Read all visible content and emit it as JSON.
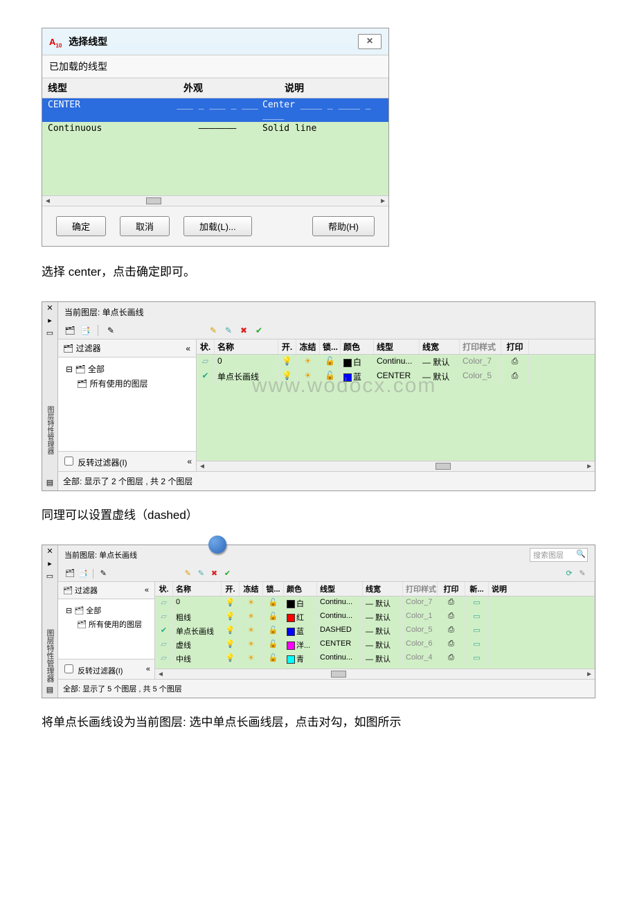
{
  "dialog1": {
    "title": "选择线型",
    "section_label": "已加载的线型",
    "headers": {
      "linetype": "线型",
      "appearance": "外观",
      "description": "说明"
    },
    "rows": [
      {
        "name": "CENTER",
        "appearance": "___ _ ___ _ ___",
        "desc": "Center ____ _ ____ _ ____"
      },
      {
        "name": "Continuous",
        "appearance": "———————",
        "desc": "Solid line"
      }
    ],
    "buttons": {
      "ok": "确定",
      "cancel": "取消",
      "load": "加载(L)...",
      "help": "帮助(H)"
    }
  },
  "text1": "选择 center，点击确定即可。",
  "panel2": {
    "current_label": "当前图层: 单点长画线",
    "filter_label": "过滤器",
    "tree_all": "全部",
    "tree_used": "所有使用的图层",
    "invert_filter": "反转过滤器(I)",
    "headers": {
      "status": "状.",
      "name": "名称",
      "on": "开.",
      "freeze": "冻结",
      "lock": "锁...",
      "color": "颜色",
      "linetype": "线型",
      "lineweight": "线宽",
      "plotstyle": "打印样式",
      "plot": "打印"
    },
    "rows": [
      {
        "status": "▱",
        "name": "0",
        "on": "💡",
        "freeze": "☀",
        "lock": "🔓",
        "color_hex": "#000000",
        "color_name": "白",
        "linetype": "Continu...",
        "lw": "— 默认",
        "ps": "Color_7",
        "plot": "⎙"
      },
      {
        "status": "✔",
        "name": "单点长画线",
        "on": "💡",
        "freeze": "☀",
        "lock": "🔓",
        "color_hex": "#0000ff",
        "color_name": "蓝",
        "linetype": "CENTER",
        "lw": "— 默认",
        "ps": "Color_5",
        "plot": "⎙"
      }
    ],
    "status_line": "全部: 显示了 2 个图层 , 共 2 个图层",
    "watermark": "www.wodocx.com"
  },
  "text2": "同理可以设置虚线（dashed）",
  "panel3": {
    "current_label": "当前图层: 单点长画线",
    "search_placeholder": "搜索图层",
    "filter_label": "过滤器",
    "tree_all": "全部",
    "tree_used": "所有使用的图层",
    "invert_filter": "反转过滤器(I)",
    "headers": {
      "status": "状.",
      "name": "名称",
      "on": "开.",
      "freeze": "冻结",
      "lock": "锁...",
      "color": "颜色",
      "linetype": "线型",
      "lineweight": "线宽",
      "plotstyle": "打印样式",
      "plot": "打印",
      "new": "新...",
      "desc": "说明"
    },
    "rows": [
      {
        "status": "▱",
        "name": "0",
        "color_hex": "#000000",
        "color_name": "白",
        "linetype": "Continu...",
        "lw": "— 默认",
        "ps": "Color_7"
      },
      {
        "status": "▱",
        "name": "粗线",
        "color_hex": "#ff0000",
        "color_name": "红",
        "linetype": "Continu...",
        "lw": "— 默认",
        "ps": "Color_1"
      },
      {
        "status": "✔",
        "name": "单点长画线",
        "color_hex": "#0000ff",
        "color_name": "蓝",
        "linetype": "DASHED",
        "lw": "— 默认",
        "ps": "Color_5"
      },
      {
        "status": "▱",
        "name": "虚线",
        "color_hex": "#ff00ff",
        "color_name": "洋...",
        "linetype": "CENTER",
        "lw": "— 默认",
        "ps": "Color_6"
      },
      {
        "status": "▱",
        "name": "中线",
        "color_hex": "#00ffff",
        "color_name": "青",
        "linetype": "Continu...",
        "lw": "— 默认",
        "ps": "Color_4"
      }
    ],
    "status_line": "全部: 显示了 5 个图层 , 共 5 个图层"
  },
  "text3": "将单点长画线设为当前图层: 选中单点长画线层，点击对勾，如图所示"
}
